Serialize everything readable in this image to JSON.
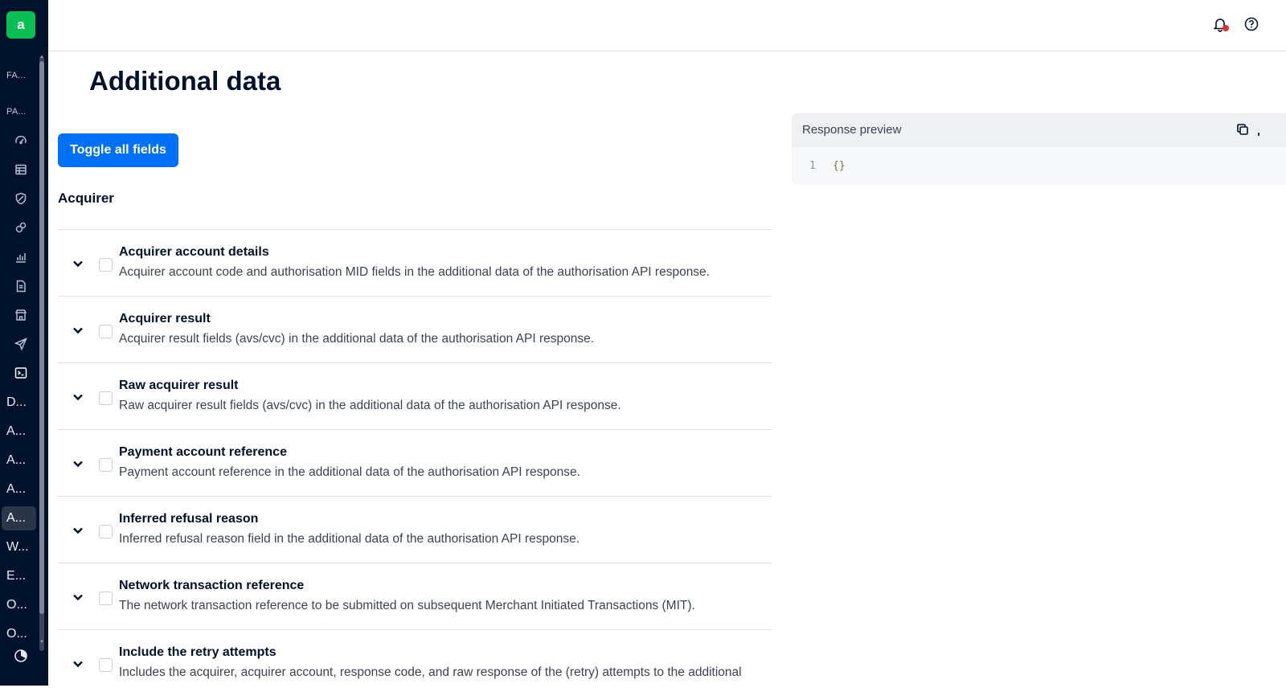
{
  "sidebar": {
    "logo_letter": "a",
    "sections": [
      "FA...",
      "PA..."
    ],
    "icons": [
      "dashboard-icon",
      "table-icon",
      "shield-icon",
      "link-icon",
      "chart-icon",
      "document-icon",
      "store-icon",
      "send-icon",
      "terminal-icon"
    ],
    "nav_items": [
      "D...",
      "A...",
      "A...",
      "A...",
      "A...",
      "W...",
      "E...",
      "O...",
      "O..."
    ],
    "selected_index": 4
  },
  "topbar": {
    "notification_icon": "bell-icon",
    "help_icon": "help-icon"
  },
  "page": {
    "title": "Additional data",
    "toggle_label": "Toggle all fields",
    "group_title": "Acquirer",
    "fields": [
      {
        "title": "Acquirer account details",
        "description": "Acquirer account code and authorisation MID fields in the additional data of the authorisation API response."
      },
      {
        "title": "Acquirer result",
        "description": "Acquirer result fields (avs/cvc) in the additional data of the authorisation API response."
      },
      {
        "title": "Raw acquirer result",
        "description": "Raw acquirer result fields (avs/cvc) in the additional data of the authorisation API response."
      },
      {
        "title": "Payment account reference",
        "description": "Payment account reference in the additional data of the authorisation API response."
      },
      {
        "title": "Inferred refusal reason",
        "description": "Inferred refusal reason field in the additional data of the authorisation API response."
      },
      {
        "title": "Network transaction reference",
        "description": "The network transaction reference to be submitted on subsequent Merchant Initiated Transactions (MIT)."
      },
      {
        "title": "Include the retry attempts",
        "description": "Includes the acquirer, acquirer account, response code, and raw response of the (retry) attempts to the additional"
      }
    ]
  },
  "preview": {
    "title": "Response preview",
    "line_number": "1",
    "code": "{}"
  },
  "colors": {
    "sidebar_bg": "#00112c",
    "logo_green": "#0abf53",
    "primary_button": "#0070f5",
    "notification_dot": "#e22d2d"
  }
}
